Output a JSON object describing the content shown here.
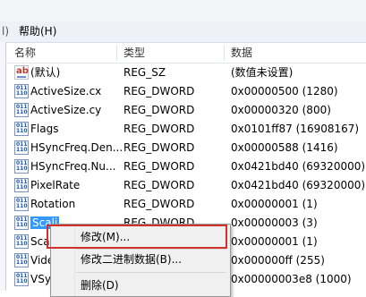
{
  "menu": {
    "prev_fragment": "l)",
    "help_label": "帮助(H)"
  },
  "columns": {
    "name": "名称",
    "type": "类型",
    "data": "数据"
  },
  "rows": [
    {
      "icon": "string-value-icon",
      "name": "(默认)",
      "type": "REG_SZ",
      "data": "(数值未设置)"
    },
    {
      "icon": "binary-value-icon",
      "name": "ActiveSize.cx",
      "type": "REG_DWORD",
      "data": "0x00000500 (1280)"
    },
    {
      "icon": "binary-value-icon",
      "name": "ActiveSize.cy",
      "type": "REG_DWORD",
      "data": "0x00000320 (800)"
    },
    {
      "icon": "binary-value-icon",
      "name": "Flags",
      "type": "REG_DWORD",
      "data": "0x0101ff87 (16908167)"
    },
    {
      "icon": "binary-value-icon",
      "name": "HSyncFreq.Den...",
      "type": "REG_DWORD",
      "data": "0x00000588 (1416)"
    },
    {
      "icon": "binary-value-icon",
      "name": "HSyncFreq.Nu...",
      "type": "REG_DWORD",
      "data": "0x0421bd40 (69320000)"
    },
    {
      "icon": "binary-value-icon",
      "name": "PixelRate",
      "type": "REG_DWORD",
      "data": "0x0421bd40 (69320000)"
    },
    {
      "icon": "binary-value-icon",
      "name": "Rotation",
      "type": "REG_DWORD",
      "data": "0x00000001 (1)"
    },
    {
      "icon": "binary-value-icon",
      "name": "Scali",
      "type": "REG_DWORD",
      "data": "0x00000003 (3)",
      "selected": true
    },
    {
      "icon": "binary-value-icon",
      "name": "Sca",
      "type": "",
      "data": "0x00000001 (1)"
    },
    {
      "icon": "binary-value-icon",
      "name": "Vide",
      "type": "",
      "data": "0x000000ff (255)"
    },
    {
      "icon": "binary-value-icon",
      "name": "VSy",
      "type": "",
      "data": "0x00000003e8 (1000)"
    }
  ],
  "context_menu": {
    "modify": "修改(M)...",
    "modify_binary": "修改二进制数据(B)...",
    "delete": "删除(D)"
  },
  "colors": {
    "highlight": "#d0312d",
    "selection": "#3399ff"
  }
}
